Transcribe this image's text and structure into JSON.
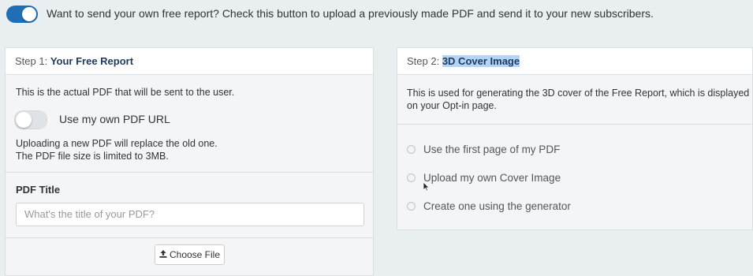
{
  "top": {
    "toggle_state": "on",
    "text": "Want to send your own free report? Check this button to upload a previously made PDF and send it to your new subscribers."
  },
  "left_panel": {
    "step_label": "Step 1:",
    "step_title": "Your Free Report",
    "description": "This is the actual PDF that will be sent to the user.",
    "toggle_label": "Use my own PDF URL",
    "toggle_state": "off",
    "note_line1": "Uploading a new PDF will replace the old one.",
    "note_line2": "The PDF file size is limited to 3MB.",
    "pdf_title_label": "PDF Title",
    "pdf_title_placeholder": "What's the title of your PDF?",
    "pdf_title_value": "",
    "choose_file_label": "Choose File"
  },
  "right_panel": {
    "step_label": "Step 2:",
    "step_title": "3D Cover Image",
    "description_line1": "This is used for generating the 3D cover of the Free Report, which is displayed",
    "description_line2": "on your Opt-in page.",
    "options": [
      {
        "label": "Use the first page of my PDF",
        "selected": false
      },
      {
        "label": "Upload my own Cover Image",
        "selected": false
      },
      {
        "label": "Create one using the generator",
        "selected": false
      }
    ]
  },
  "colors": {
    "accent": "#1e6fb5",
    "title_text": "#1f3a5a",
    "selection_highlight": "#b3d4f5",
    "background": "#e9eef1"
  }
}
